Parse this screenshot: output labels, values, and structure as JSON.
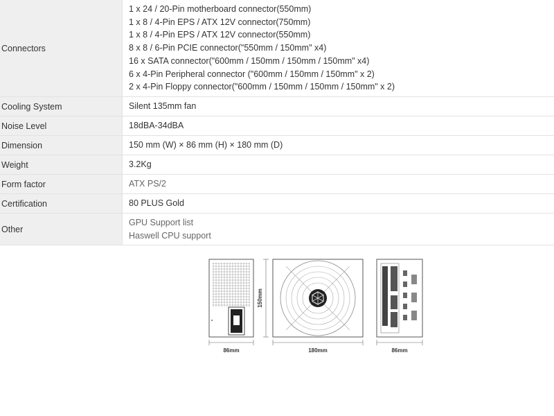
{
  "specs": [
    {
      "label": "Connectors",
      "values": [
        "1 x 24 / 20-Pin motherboard connector(550mm)",
        "1 x 8 / 4-Pin EPS / ATX 12V connector(750mm)",
        "1 x 8 / 4-Pin EPS / ATX 12V connector(550mm)",
        "8 x 8 / 6-Pin PCIE connector(\"550mm / 150mm\" x4)",
        "16 x SATA connector(\"600mm / 150mm / 150mm / 150mm\" x4)",
        "6 x 4-Pin Peripheral connector (\"600mm / 150mm / 150mm\" x 2)",
        "2 x 4-Pin Floppy connector(\"600mm / 150mm / 150mm / 150mm\" x 2)"
      ]
    },
    {
      "label": "Cooling System",
      "values": [
        "Silent 135mm fan"
      ]
    },
    {
      "label": "Noise Level",
      "values": [
        "18dBA-34dBA"
      ]
    },
    {
      "label": "Dimension",
      "values": [
        "150 mm (W) × 86 mm (H) × 180 mm (D)"
      ]
    },
    {
      "label": "Weight",
      "values": [
        "3.2Kg"
      ]
    },
    {
      "label": "Form factor",
      "values": [
        "ATX PS/2"
      ],
      "muted": true
    },
    {
      "label": "Certification",
      "values": [
        "80 PLUS Gold"
      ]
    },
    {
      "label": "Other",
      "values": [
        "GPU Support list",
        "Haswell CPU support"
      ],
      "muted": true
    }
  ],
  "diagram": {
    "front_width": "86mm",
    "height": "150mm",
    "depth": "180mm",
    "side_width": "86mm"
  }
}
